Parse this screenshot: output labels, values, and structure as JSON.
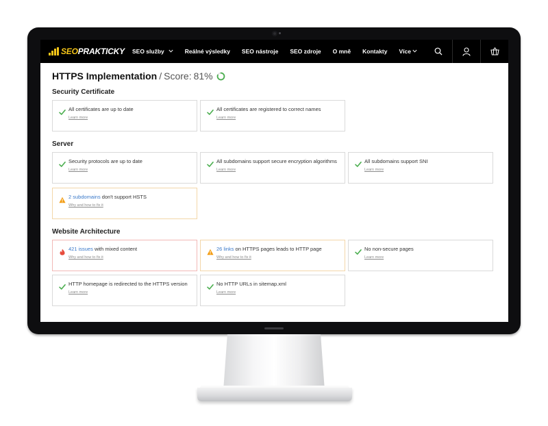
{
  "colors": {
    "accent_yellow": "#f5c518",
    "nav_bg": "#000000",
    "success_green": "#4caf50",
    "warning_orange": "#f39c12",
    "error_red": "#e74c3c",
    "link_blue": "#3a79c9"
  },
  "nav": {
    "logo": {
      "prefix": "SEO",
      "suffix": "PRAKTICKY"
    },
    "items": [
      {
        "label": "SEO služby",
        "has_chevron": true
      },
      {
        "label": "Reálné výsledky",
        "has_chevron": false
      },
      {
        "label": "SEO nástroje",
        "has_chevron": false
      },
      {
        "label": "SEO zdroje",
        "has_chevron": false
      },
      {
        "label": "O mně",
        "has_chevron": false
      },
      {
        "label": "Kontakty",
        "has_chevron": false
      },
      {
        "label": "Více",
        "has_chevron": true
      }
    ],
    "icons": [
      "search-icon",
      "user-icon",
      "basket-icon"
    ]
  },
  "page": {
    "title": "HTTPS Implementation",
    "separator": "/",
    "score_label": "Score:",
    "score_value": "81%",
    "score_fraction": 0.81
  },
  "sections": [
    {
      "title": "Security Certificate",
      "cards": [
        {
          "status": "ok",
          "text": "All certificates are up to date",
          "link_text": "",
          "sub": "Learn more"
        },
        {
          "status": "ok",
          "text": "All certificates are registered to correct names",
          "link_text": "",
          "sub": "Learn more"
        }
      ]
    },
    {
      "title": "Server",
      "cards": [
        {
          "status": "ok",
          "text": "Security protocols are up to date",
          "link_text": "",
          "sub": "Learn more"
        },
        {
          "status": "ok",
          "text": "All subdomains support secure encryption algorithms",
          "link_text": "",
          "sub": "Learn more"
        },
        {
          "status": "ok",
          "text": "All subdomains support SNI",
          "link_text": "",
          "sub": "Learn more"
        },
        {
          "status": "warning",
          "link_text": "2 subdomains",
          "text": " don't support HSTS",
          "sub": "Why and how to fix it"
        }
      ]
    },
    {
      "title": "Website Architecture",
      "cards": [
        {
          "status": "error",
          "link_text": "421 issues",
          "text": " with mixed content",
          "sub": "Why and how to fix it"
        },
        {
          "status": "warning",
          "link_text": "26 links",
          "text": " on HTTPS pages leads to HTTP page",
          "sub": "Why and how to fix it"
        },
        {
          "status": "ok",
          "text": "No non-secure pages",
          "link_text": "",
          "sub": "Learn more"
        },
        {
          "status": "ok",
          "text": "HTTP homepage is redirected to the HTTPS version",
          "link_text": "",
          "sub": "Learn more"
        },
        {
          "status": "ok",
          "text": "No HTTP URLs in sitemap.xml",
          "link_text": "",
          "sub": "Learn more"
        }
      ]
    }
  ]
}
